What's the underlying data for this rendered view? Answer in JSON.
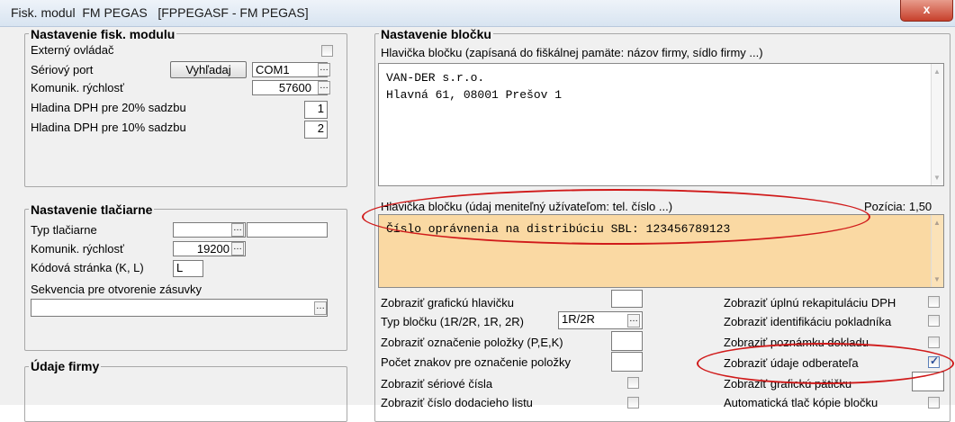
{
  "window": {
    "title": "Fisk. modul  FM PEGAS   [FPPEGASF - FM PEGAS]",
    "close_label": "x"
  },
  "fisk_group": {
    "title": "Nastavenie fisk. modulu",
    "externy_label": "Externý ovládač",
    "port_label": "Sériový port",
    "search_button": "Vyhľadaj",
    "port_value": "COM1",
    "speed_label": "Komunik. rýchlosť",
    "speed_value": "57600",
    "dph20_label": "Hladina DPH pre 20% sadzbu",
    "dph20_value": "1",
    "dph10_label": "Hladina DPH pre 10% sadzbu",
    "dph10_value": "2"
  },
  "printer_group": {
    "title": "Nastavenie tlačiarne",
    "type_label": "Typ tlačiarne",
    "type_value": "",
    "speed_label": "Komunik. rýchlosť",
    "speed_value": "19200",
    "codepage_label": "Kódová stránka (K, L)",
    "codepage_value": "L",
    "drawer_label": "Sekvencia pre otvorenie zásuvky",
    "drawer_value": ""
  },
  "firm_group": {
    "title": "Údaje firmy"
  },
  "receipt_group": {
    "title": "Nastavenie bločku",
    "header_label": "Hlavička bločku (zapísaná do fiškálnej pamäte: názov firmy, sídlo firmy ...)",
    "header_text": "VAN-DER s.r.o.\nHlavná 61, 08001 Prešov 1",
    "header2_label": "Hlavička bločku (údaj meniteľný užívateľom: tel. číslo ...)",
    "position_label": "Pozícia: 1,50",
    "header2_text": "Číslo oprávnenia na distribúciu SBL: 123456789123",
    "left_options": [
      {
        "label": "Zobraziť grafickú hlavičku"
      },
      {
        "label": "Typ bločku (1R/2R, 1R, 2R)",
        "value": "1R/2R"
      },
      {
        "label": "Zobraziť označenie položky (P,E,K)"
      },
      {
        "label": "Počet znakov pre označenie položky"
      },
      {
        "label": "Zobraziť sériové čísla"
      },
      {
        "label": "Zobraziť číslo dodacieho listu"
      }
    ],
    "right_options": [
      {
        "label": "Zobraziť úplnú rekapituláciu DPH",
        "checked": false
      },
      {
        "label": "Zobraziť identifikáciu pokladníka",
        "checked": false
      },
      {
        "label": "Zobraziť poznámku dokladu",
        "checked": false
      },
      {
        "label": "Zobraziť údaje odberateľa",
        "checked": true
      },
      {
        "label": "Zobraziť grafickú pätičku"
      },
      {
        "label": "Automatická tlač kópie bločku",
        "checked": false
      }
    ]
  },
  "annotation_color": "#d01a1a",
  "highlight_color": "#fad9a3"
}
